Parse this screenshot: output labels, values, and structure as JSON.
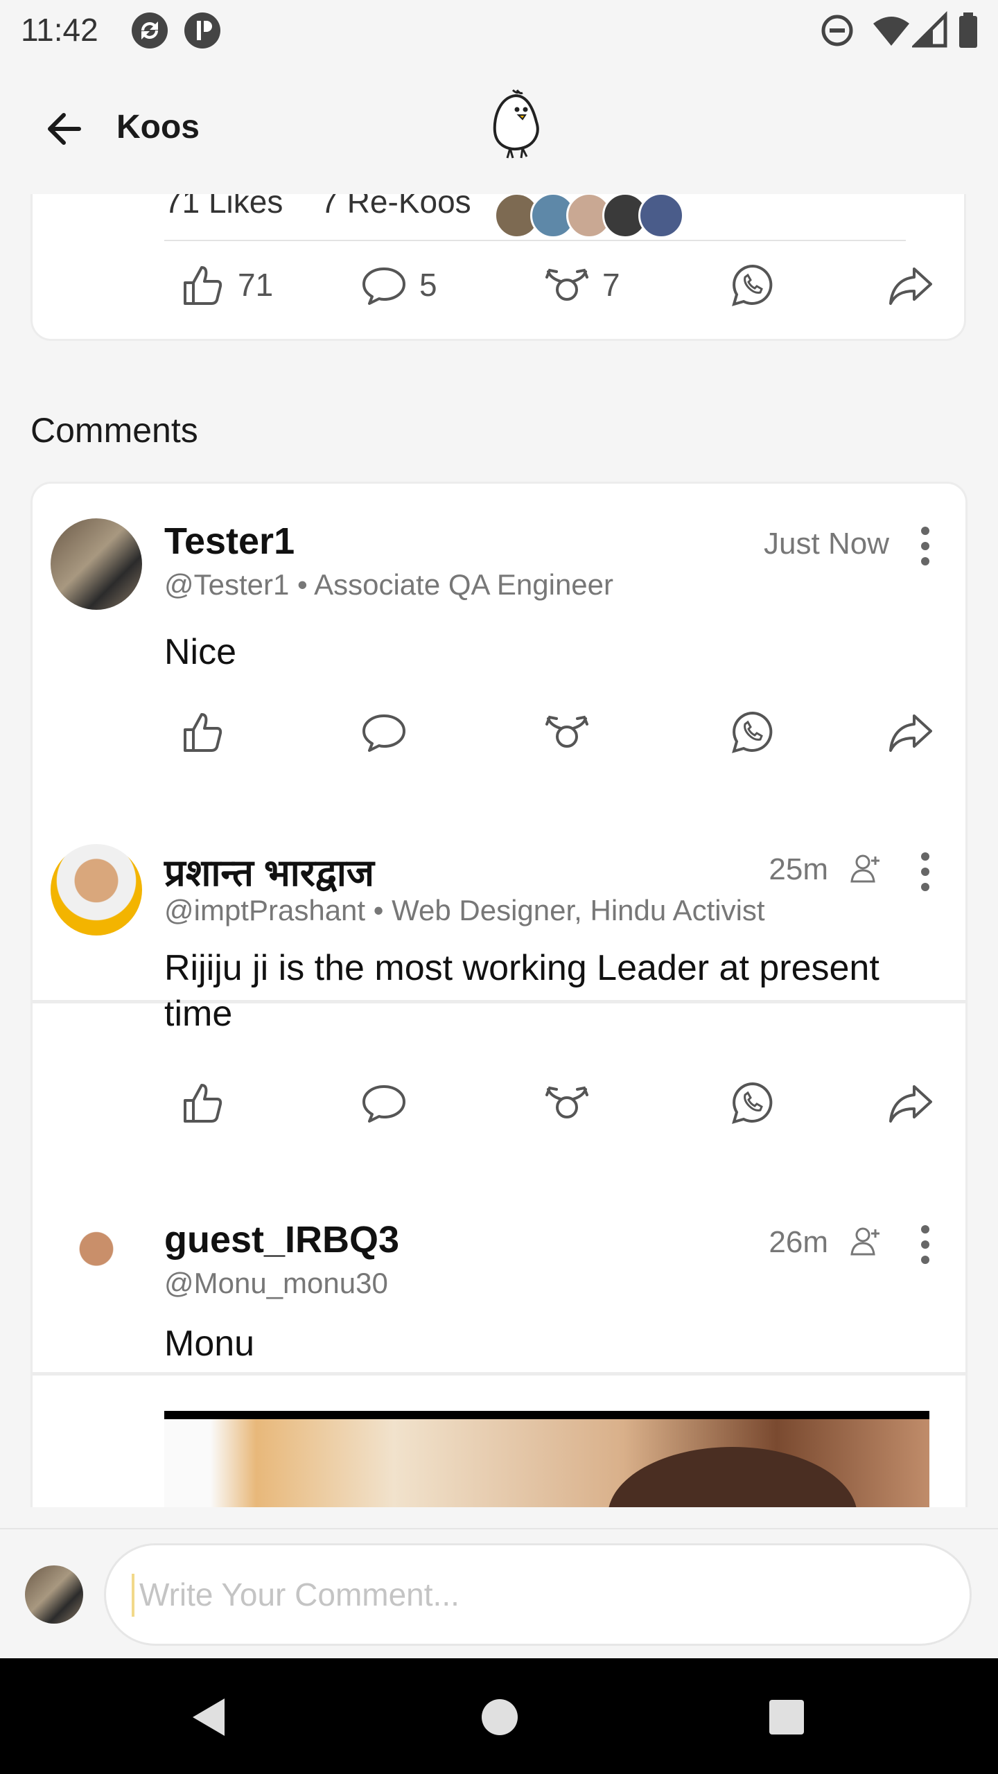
{
  "status_bar": {
    "time": "11:42"
  },
  "app_bar": {
    "title": "Koos"
  },
  "post": {
    "likes_summary": "71 Likes",
    "rekoos_summary": "7 Re-Koos",
    "like_count": "71",
    "comment_count": "5",
    "rekoo_count": "7"
  },
  "comments_heading": "Comments",
  "comments": [
    {
      "name": "Tester1",
      "handle": "@Tester1 • Associate QA Engineer",
      "time": "Just Now",
      "text": "Nice"
    },
    {
      "name": "प्रशान्त भारद्वाज",
      "handle": "@imptPrashant • Web Designer, Hindu Activist",
      "time": "25m",
      "text": "Rijiju ji is the most working Leader at present time"
    },
    {
      "name": "guest_IRBQ3",
      "handle": "@Monu_monu30",
      "time": "26m",
      "text": "Monu"
    }
  ],
  "compose": {
    "placeholder": "Write Your Comment..."
  },
  "colors": {
    "accent": "#f2d98a",
    "text": "#1a1a1a",
    "muted": "#777777",
    "background": "#f5f5f5"
  }
}
